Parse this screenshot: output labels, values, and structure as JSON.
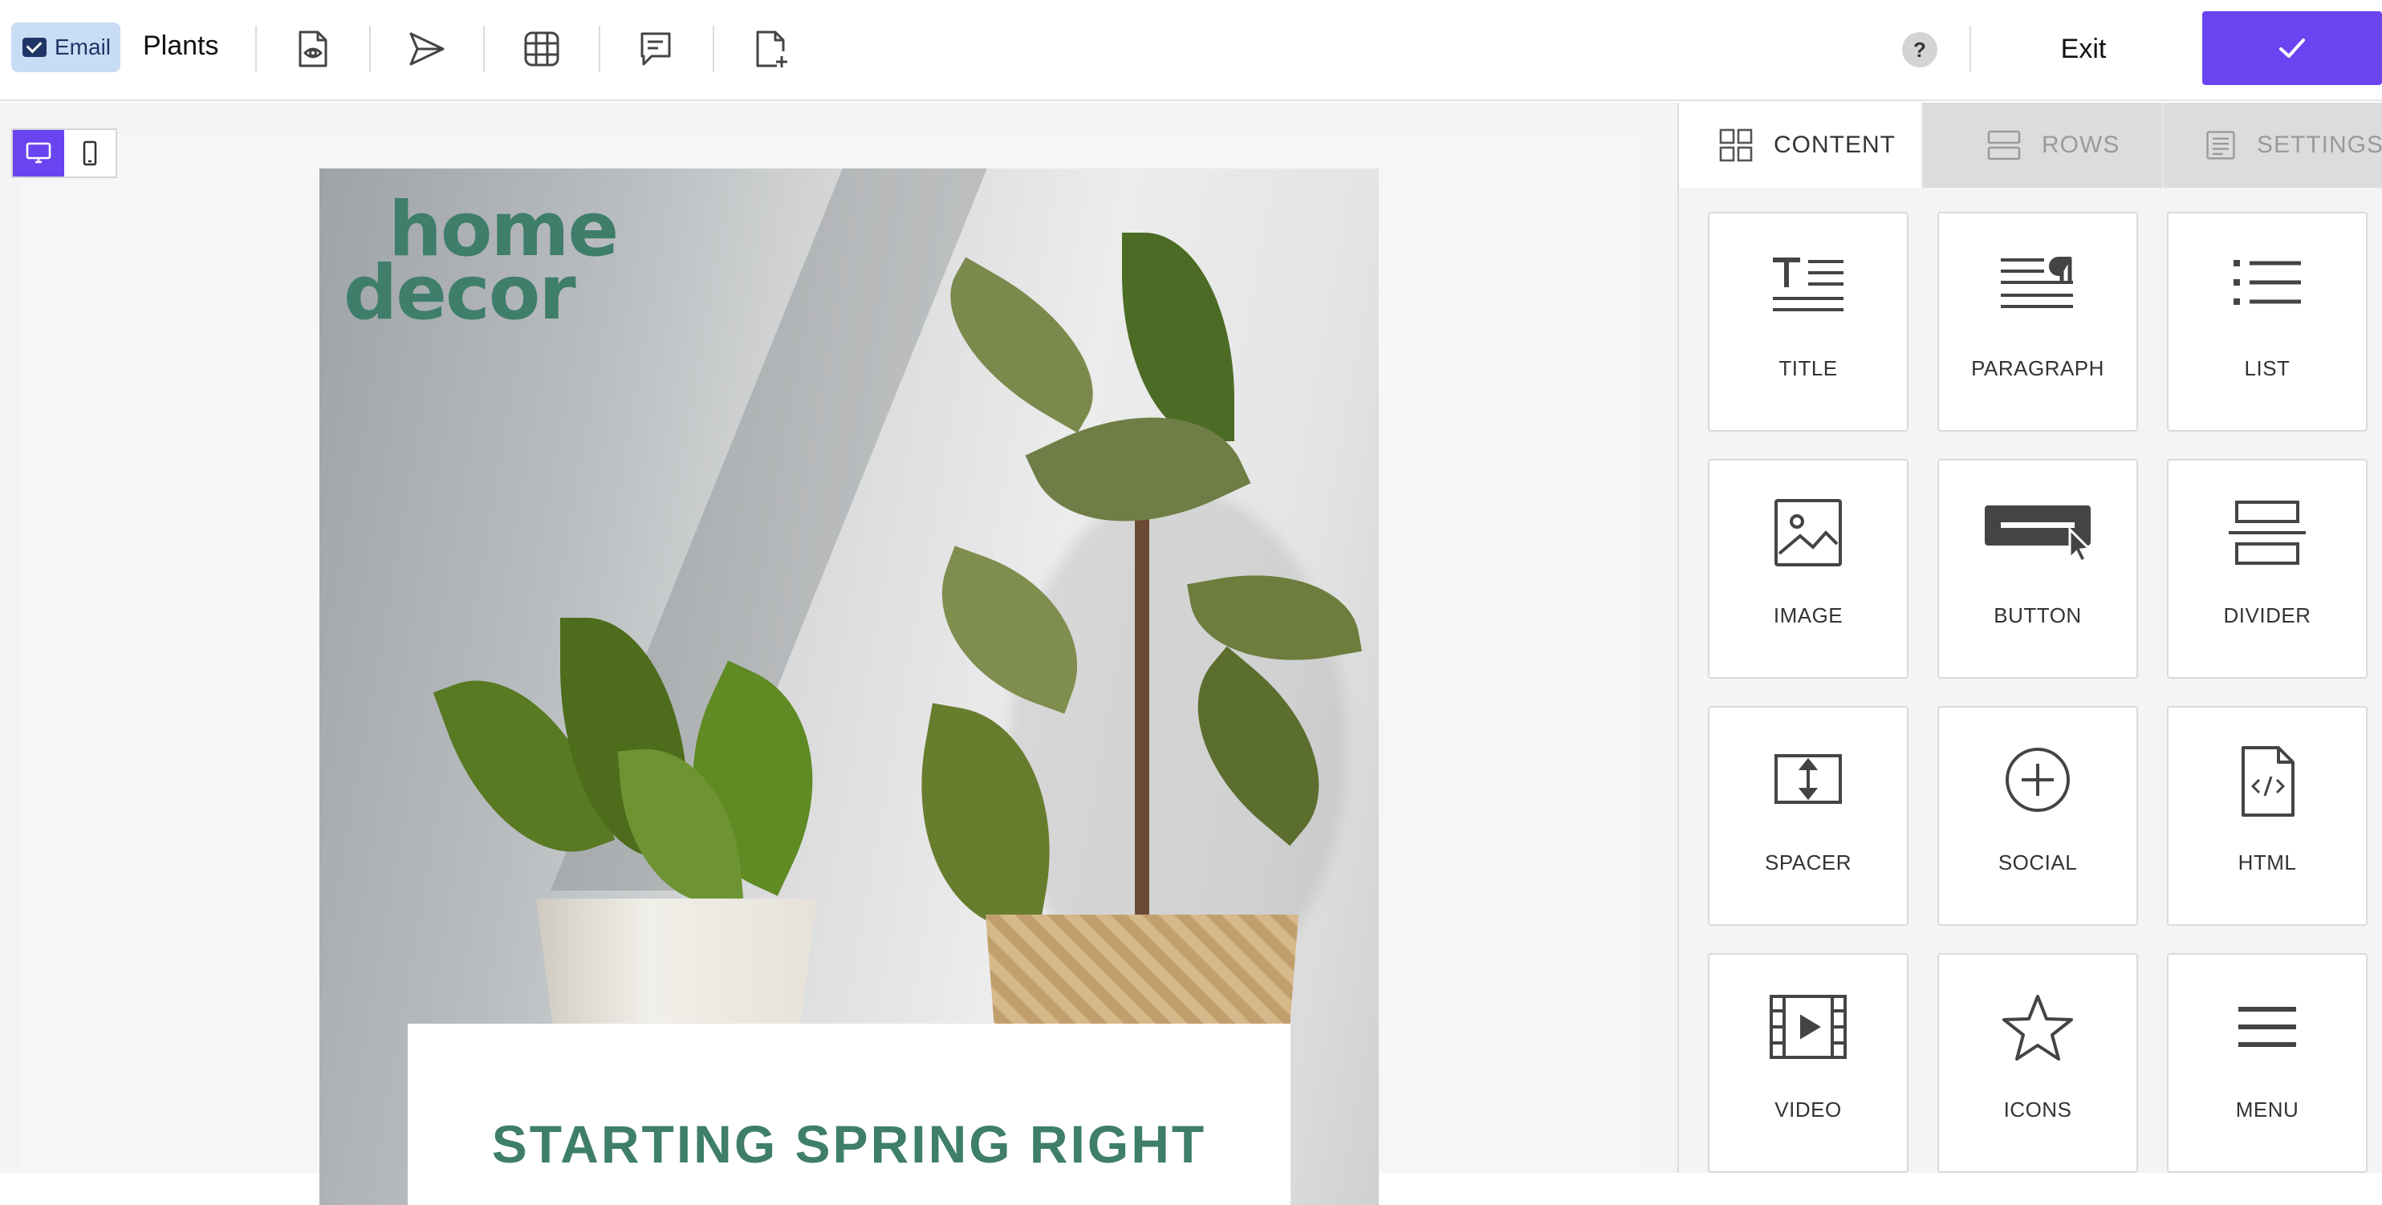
{
  "toolbar": {
    "type_label": "Email",
    "document_name": "Plants",
    "help_label": "?",
    "exit_label": "Exit",
    "icons": [
      "preview-icon",
      "send-test-icon",
      "grid-icon",
      "comments-icon",
      "new-document-icon"
    ]
  },
  "stage": {
    "view_modes": [
      "desktop",
      "mobile"
    ],
    "active_view": "desktop"
  },
  "email": {
    "logo_line1": "home",
    "logo_line2": "decor",
    "headline": "STARTING SPRING RIGHT",
    "brand_color": "#3e7e6a"
  },
  "panel": {
    "tabs": [
      {
        "label": "CONTENT",
        "icon": "content-grid-icon",
        "active": true
      },
      {
        "label": "ROWS",
        "icon": "rows-icon",
        "active": false
      },
      {
        "label": "SETTINGS",
        "icon": "settings-icon",
        "active": false
      }
    ],
    "blocks": [
      {
        "label": "TITLE",
        "icon": "title-icon"
      },
      {
        "label": "PARAGRAPH",
        "icon": "paragraph-icon"
      },
      {
        "label": "LIST",
        "icon": "list-icon"
      },
      {
        "label": "IMAGE",
        "icon": "image-icon"
      },
      {
        "label": "BUTTON",
        "icon": "button-icon"
      },
      {
        "label": "DIVIDER",
        "icon": "divider-icon"
      },
      {
        "label": "SPACER",
        "icon": "spacer-icon"
      },
      {
        "label": "SOCIAL",
        "icon": "social-icon"
      },
      {
        "label": "HTML",
        "icon": "html-icon"
      },
      {
        "label": "VIDEO",
        "icon": "video-icon"
      },
      {
        "label": "ICONS",
        "icon": "star-icon"
      },
      {
        "label": "MENU",
        "icon": "menu-icon"
      }
    ]
  },
  "colors": {
    "accent": "#6a44f0",
    "chip_background": "#c9dcf5",
    "chip_text": "#1f3566"
  }
}
